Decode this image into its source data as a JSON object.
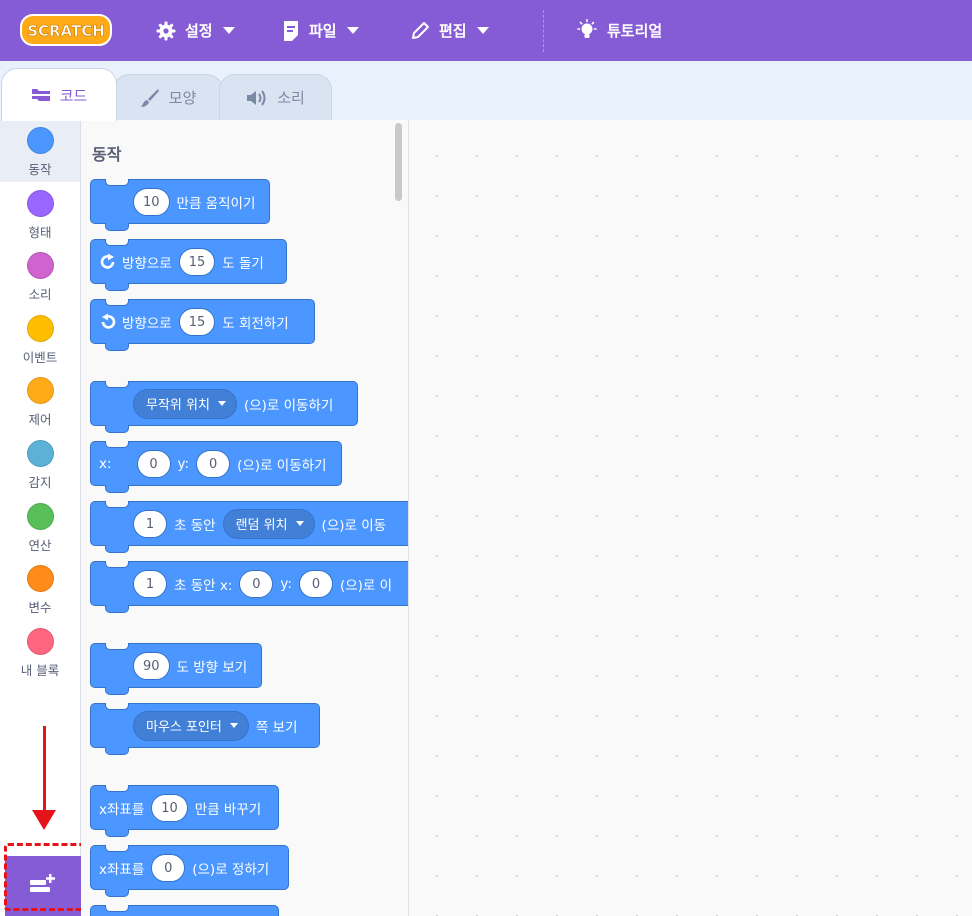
{
  "menubar": {
    "logo_text": "SCRATCH",
    "items": [
      {
        "label": "설정",
        "icon": "gear-icon"
      },
      {
        "label": "파일",
        "icon": "file-icon"
      },
      {
        "label": "편집",
        "icon": "pencil-icon"
      },
      {
        "label": "튜토리얼",
        "icon": "lightbulb-icon"
      }
    ],
    "colors": {
      "menubar": "#855cd6",
      "accent": "#855cd6"
    }
  },
  "tabs": [
    {
      "label": "코드",
      "icon": "code-icon",
      "active": true
    },
    {
      "label": "모양",
      "icon": "brush-icon",
      "active": false
    },
    {
      "label": "소리",
      "icon": "speaker-icon",
      "active": false
    }
  ],
  "categories": [
    {
      "label": "동작",
      "color": "#4c97ff"
    },
    {
      "label": "형태",
      "color": "#9966ff"
    },
    {
      "label": "소리",
      "color": "#cf63cf"
    },
    {
      "label": "이벤트",
      "color": "#ffbf00"
    },
    {
      "label": "제어",
      "color": "#ffab19"
    },
    {
      "label": "감지",
      "color": "#5cb1d6"
    },
    {
      "label": "연산",
      "color": "#59c059"
    },
    {
      "label": "변수",
      "color": "#ff8c1a"
    },
    {
      "label": "내 블록",
      "color": "#ff6680"
    }
  ],
  "palette": {
    "title": "동작",
    "blocks": {
      "move": {
        "value": "10",
        "text": "만큼 움직이기"
      },
      "turn_right": {
        "pre": "방향으로",
        "value": "15",
        "post": "도 돌기"
      },
      "turn_left": {
        "pre": "방향으로",
        "value": "15",
        "post": "도 회전하기"
      },
      "goto": {
        "dropdown": "무작위 위치",
        "post": "(으)로 이동하기"
      },
      "goto_xy": {
        "x_label": "x:",
        "x": "0",
        "y_label": "y:",
        "y": "0",
        "post": "(으)로 이동하기"
      },
      "glide_to": {
        "value": "1",
        "mid": "초 동안",
        "dropdown": "랜덤 위치",
        "post": "(으)로 이동"
      },
      "glide_xy": {
        "value": "1",
        "mid": "초 동안 x:",
        "x": "0",
        "y_label": "y:",
        "y": "0",
        "post": "(으)로 이"
      },
      "point_dir": {
        "value": "90",
        "text": "도 방향 보기"
      },
      "point_towards": {
        "dropdown": "마우스 포인터",
        "post": "쪽 보기"
      },
      "change_x": {
        "pre": "x좌표를",
        "value": "10",
        "post": "만큼 바꾸기"
      },
      "set_x": {
        "pre": "x좌표를",
        "value": "0",
        "post": "(으)로 정하기"
      }
    }
  },
  "extension_button": {
    "icon": "add-extension-icon"
  }
}
